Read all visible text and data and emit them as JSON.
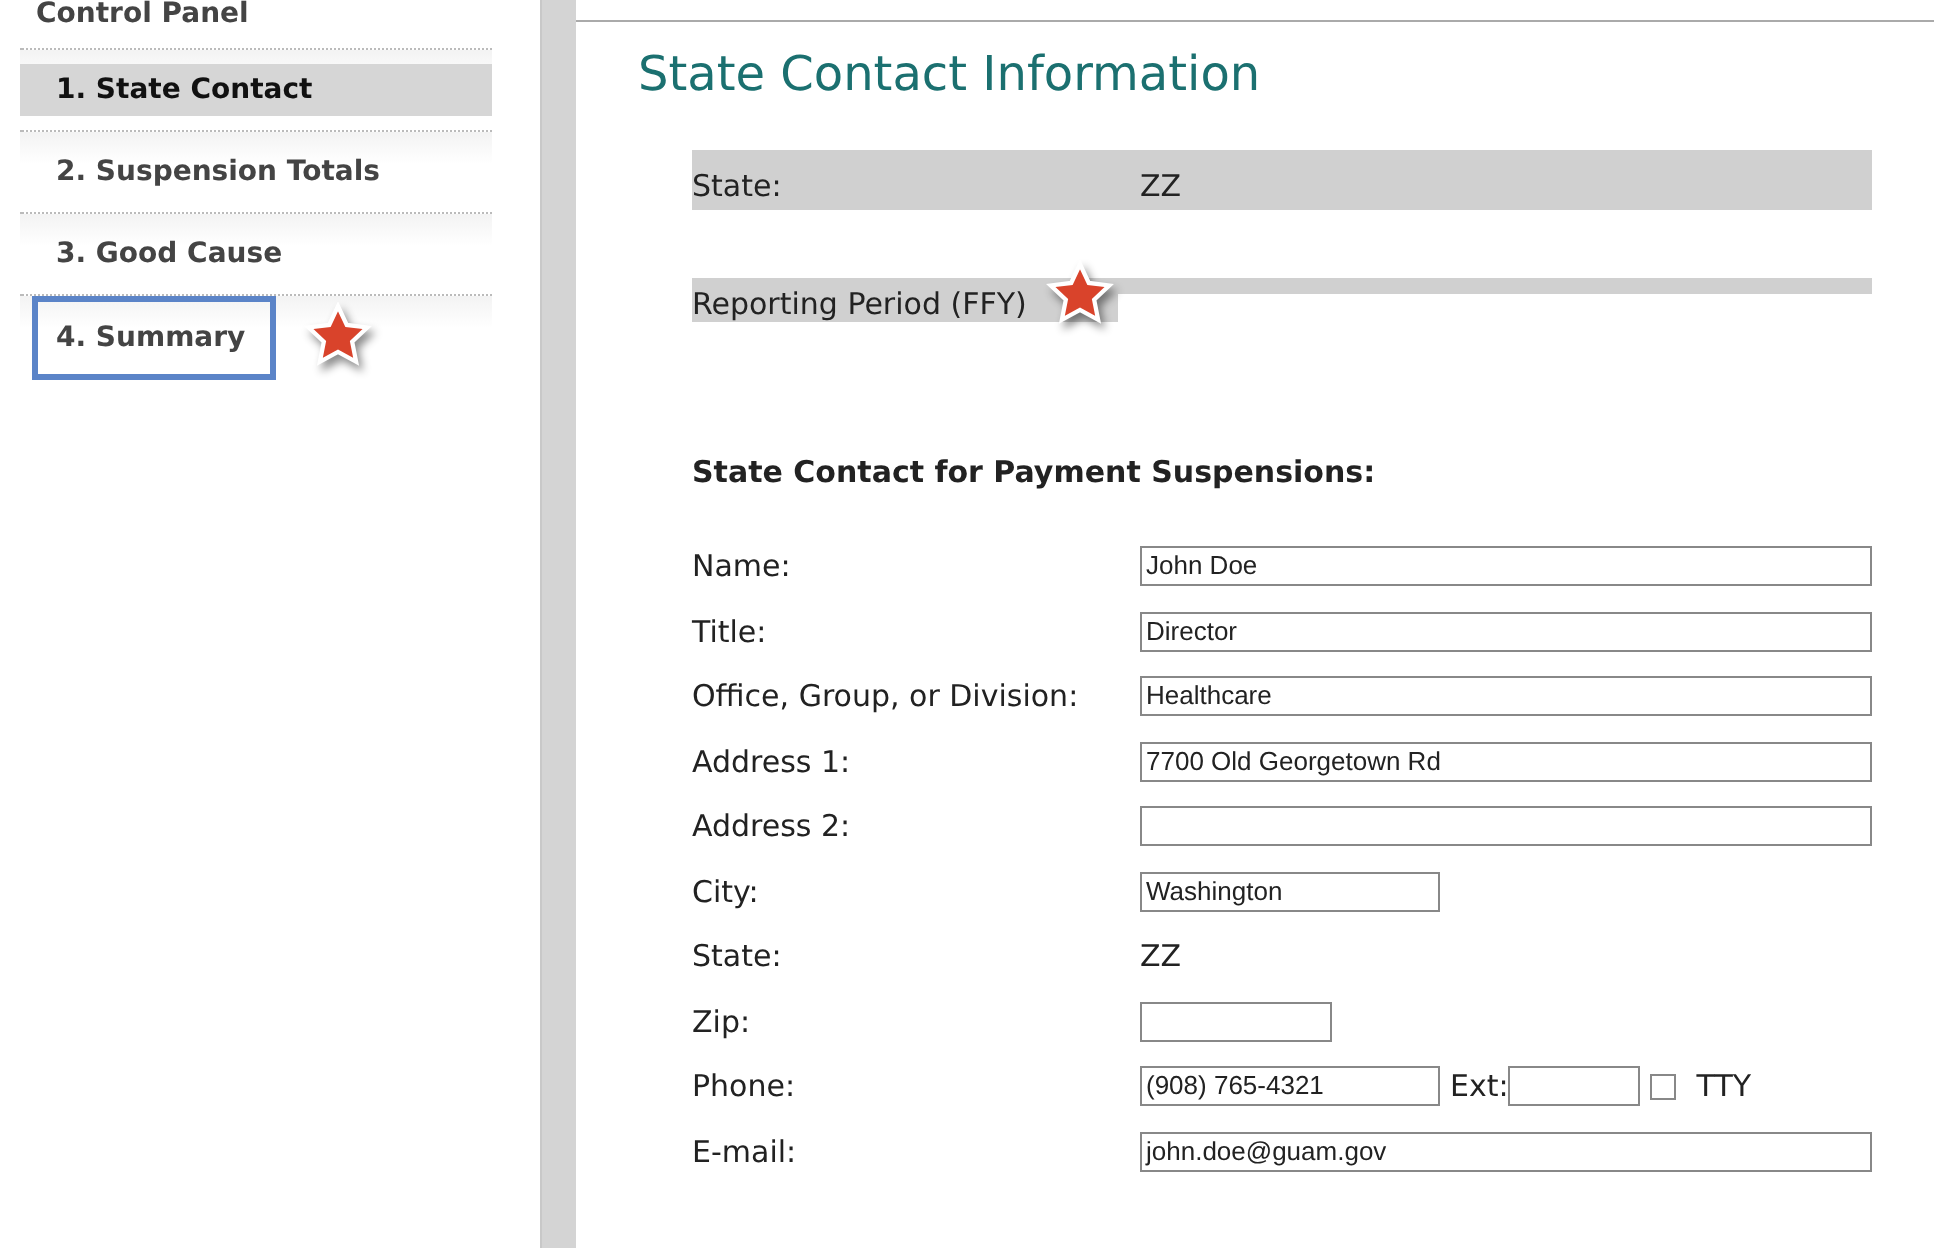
{
  "sidebar": {
    "title": "Control Panel",
    "items": [
      {
        "label": "1. State Contact",
        "selected": true,
        "outlined": false,
        "starred": false
      },
      {
        "label": "2. Suspension Totals",
        "selected": false,
        "outlined": false,
        "starred": false
      },
      {
        "label": "3. Good Cause",
        "selected": false,
        "outlined": false,
        "starred": false
      },
      {
        "label": "4. Summary",
        "selected": false,
        "outlined": true,
        "starred": true
      }
    ]
  },
  "page_title": "State Contact Information",
  "summary_rows": [
    {
      "label": "State:",
      "value": "ZZ",
      "starred": false
    },
    {
      "label": "Reporting Period (FFY)",
      "starred": true
    }
  ],
  "section_title": "State Contact for Payment Suspensions:",
  "fields": [
    {
      "kind": "wide",
      "label": "Name:",
      "value": "John Doe"
    },
    {
      "kind": "wide",
      "label": "Title:",
      "value": "Director"
    },
    {
      "kind": "wide",
      "label": "Office, Group, or Division:",
      "value": "Healthcare"
    },
    {
      "kind": "wide",
      "label": "Address 1:",
      "value": "7700 Old Georgetown Rd"
    },
    {
      "kind": "wide",
      "label": "Address 2:"
    },
    {
      "kind": "medium",
      "label": "City:",
      "value": "Washington"
    },
    {
      "kind": "text",
      "label": "State:",
      "value": "ZZ"
    },
    {
      "kind": "small",
      "label": "Zip:"
    },
    {
      "kind": "phone",
      "label": "Phone:",
      "value": "(908) 765-4321",
      "ext_label": "Ext:",
      "tty_label": "TTY",
      "tty": false
    },
    {
      "kind": "wide",
      "label": "E-mail:",
      "value": "john.doe@guam.gov"
    }
  ]
}
